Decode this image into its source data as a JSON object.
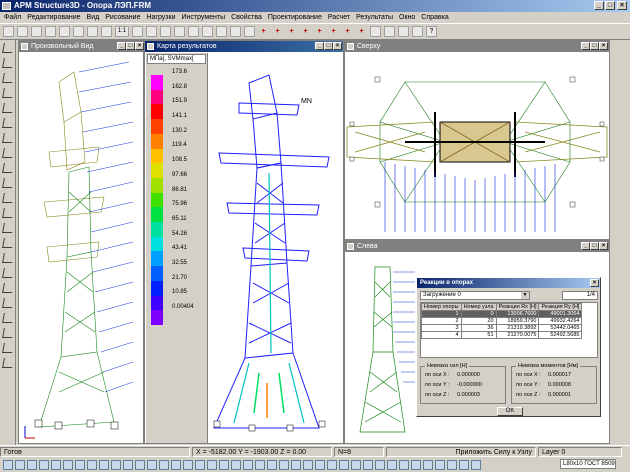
{
  "app": {
    "title": "APM Structure3D - Опора ЛЭП.FRM"
  },
  "menu": [
    "Файл",
    "Редактирование",
    "Вид",
    "Рисование",
    "Нагрузки",
    "Инструменты",
    "Свойства",
    "Проектирование",
    "Расчет",
    "Результаты",
    "Окно",
    "Справка"
  ],
  "toolbar": {
    "zoom_label": "1:1"
  },
  "windows": {
    "free_view": "Произвольный Вид",
    "result_map": "Карта результатов",
    "top_view": "Сверху",
    "left_view": "Слева"
  },
  "legend": {
    "header": "МПа], SVMmax[",
    "values": [
      "173.6",
      "162.8",
      "151.9",
      "141.1",
      "130.2",
      "119.4",
      "108.5",
      "97.66",
      "86.81",
      "75.96",
      "65.11",
      "54.26",
      "43.41",
      "32.55",
      "21.70",
      "10.85",
      "0.00404"
    ],
    "colors": [
      "#ff00ff",
      "#ff0080",
      "#ff0000",
      "#ff4000",
      "#ff8000",
      "#ffc000",
      "#e0e000",
      "#a0e000",
      "#40e000",
      "#00e040",
      "#00e0a0",
      "#00e0e0",
      "#00a0ff",
      "#0060ff",
      "#0020ff",
      "#4000ff",
      "#8000ff"
    ]
  },
  "result_label": "MN",
  "dialog": {
    "title": "Реакции в опорах",
    "loadcase": "Загружение 0",
    "count": "1/4",
    "headers": [
      "Номер опоры",
      "Номер узла",
      "Реакция Rx [H]",
      "Реакция Ry [H]"
    ],
    "rows": [
      [
        "1",
        "0",
        "13006.7600",
        "49001.3064"
      ],
      [
        "2",
        "20",
        "18959.3790",
        "49932.4264"
      ],
      [
        "3",
        "36",
        "21319.3892",
        "52442.0465"
      ],
      [
        "4",
        "51",
        "21270.0075",
        "52492.5685"
      ]
    ],
    "force_group": "Невязка сил [H]",
    "moment_group": "Невязка моментов [Нм]",
    "force_rows": [
      [
        "по оси X :",
        "0.000000"
      ],
      [
        "по оси Y :",
        "-0.000000"
      ],
      [
        "по оси Z :",
        "0.000003"
      ]
    ],
    "moment_rows": [
      [
        "по оси X :",
        "0.000017"
      ],
      [
        "по оси Y :",
        "0.000008"
      ],
      [
        "по оси Z :",
        "0.000001"
      ]
    ],
    "ok": "OK"
  },
  "status": {
    "ready": "Готов",
    "coords": "X = -5182.00 Y = -1903.00 Z = 0.00",
    "n": "N=8",
    "hint": "Приложить Силу к Узлу",
    "layer": "Layer 0"
  },
  "bottom": {
    "profile": "L80x10 ГОСТ 8509-"
  }
}
